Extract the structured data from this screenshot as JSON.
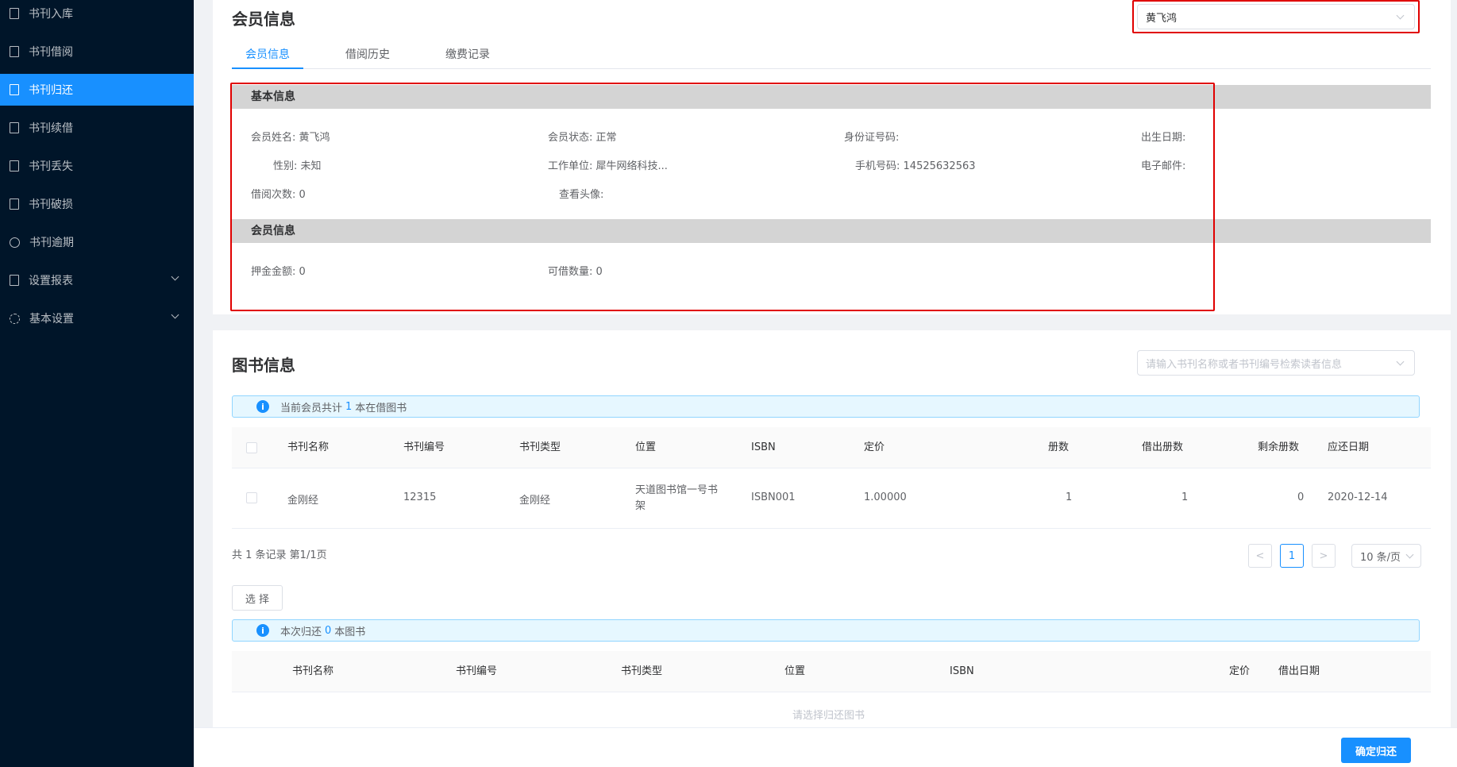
{
  "sidebar": {
    "items": [
      {
        "label": "书刊入库",
        "icon": "inbox-icon"
      },
      {
        "label": "书刊借阅",
        "icon": "book-icon"
      },
      {
        "label": "书刊归还",
        "icon": "book-icon",
        "active": true
      },
      {
        "label": "书刊续借",
        "icon": "book-icon"
      },
      {
        "label": "书刊丢失",
        "icon": "book-icon"
      },
      {
        "label": "书刊破损",
        "icon": "book-icon"
      },
      {
        "label": "书刊逾期",
        "icon": "clock-icon"
      },
      {
        "label": "设置报表",
        "icon": "report-icon",
        "expandable": true
      },
      {
        "label": "基本设置",
        "icon": "gear-icon",
        "expandable": true
      }
    ],
    "bg_color": "#001529",
    "active_color": "#1890ff"
  },
  "member": {
    "title": "会员信息",
    "selected_member": "黄飞鸿",
    "tabs": [
      "会员信息",
      "借阅历史",
      "缴费记录"
    ],
    "basic": {
      "section_title": "基本信息",
      "name_label": "会员姓名:",
      "name_value": "黄飞鸿",
      "status_label": "会员状态:",
      "status_value": "正常",
      "idcard_label": "身份证号码:",
      "idcard_value": "",
      "birth_label": "出生日期:",
      "birth_value": "",
      "gender_label": "性别:",
      "gender_value": "未知",
      "work_label": "工作单位:",
      "work_value": "犀牛网络科技...",
      "phone_label": "手机号码:",
      "phone_value": "14525632563",
      "email_label": "电子邮件:",
      "email_value": "",
      "borrow_count_label": "借阅次数:",
      "borrow_count_value": "0",
      "avatar_label": "查看头像:"
    },
    "member_info": {
      "section_title": "会员信息",
      "deposit_label": "押金金额:",
      "deposit_value": "0",
      "borrowable_label": "可借数量:",
      "borrowable_value": "0"
    }
  },
  "books": {
    "title": "图书信息",
    "search_placeholder": "请输入书刊名称或者书刊编号检索读者信息",
    "alert_prefix": "当前会员共计",
    "alert_count": "1",
    "alert_suffix": "本在借图书",
    "columns": [
      "书刊名称",
      "书刊编号",
      "书刊类型",
      "位置",
      "ISBN",
      "定价",
      "册数",
      "借出册数",
      "剩余册数",
      "应还日期"
    ],
    "rows": [
      {
        "name": "金刚经",
        "code": "12315",
        "type": "金刚经",
        "location_line1": "天道图书馆一号书",
        "location_line2": "架",
        "isbn": "ISBN001",
        "price": "1.00000",
        "copies": "1",
        "lent": "1",
        "remaining": "0",
        "due": "2020-12-14"
      }
    ],
    "pagination": {
      "summary": "共 1 条记录 第1/1页",
      "current_page": "1",
      "prev": "<",
      "next": ">",
      "page_size": "10 条/页"
    },
    "select_button": "选 择",
    "return_alert_prefix": "本次归还",
    "return_alert_count": "0",
    "return_alert_suffix": "本图书",
    "return_columns": [
      "书刊名称",
      "书刊编号",
      "书刊类型",
      "位置",
      "ISBN",
      "定价",
      "借出日期"
    ],
    "return_empty": "请选择归还图书"
  },
  "footer": {
    "confirm_button": "确定归还"
  }
}
